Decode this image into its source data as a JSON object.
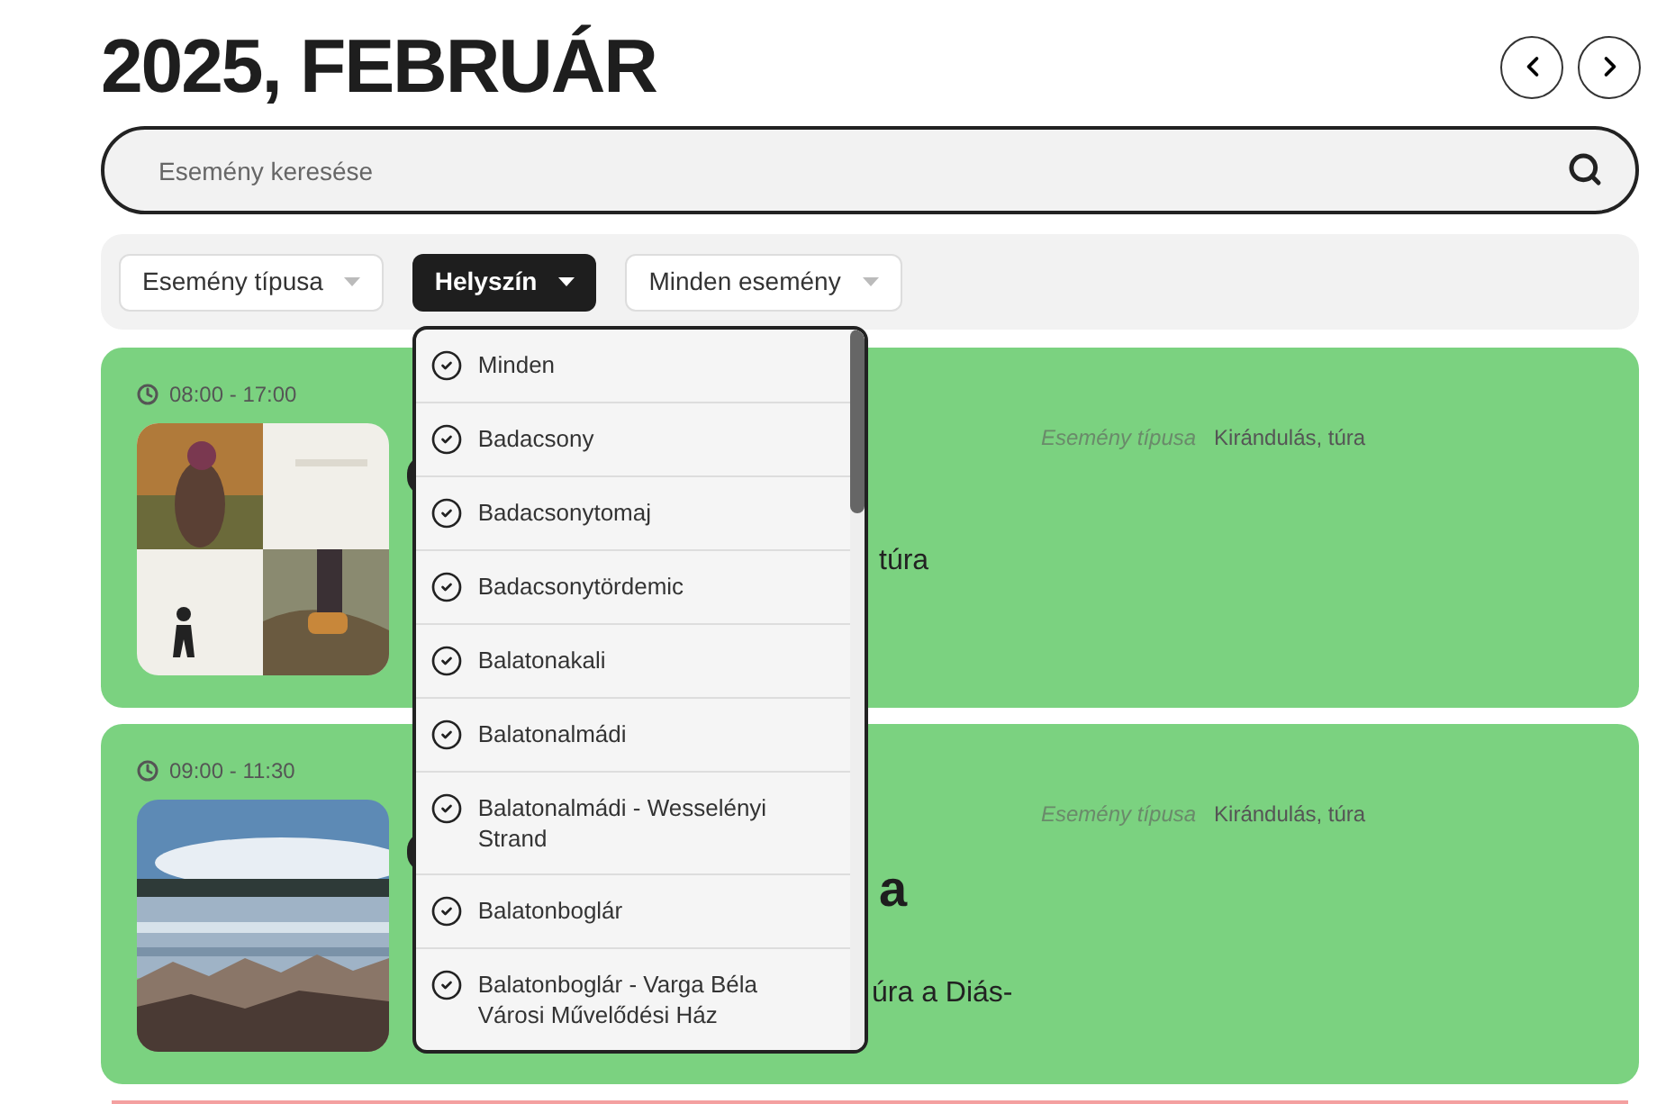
{
  "heading": "2025, FEBRUÁR",
  "search": {
    "placeholder": "Esemény keresése"
  },
  "filters": [
    {
      "label": "Esemény típusa",
      "selected": false
    },
    {
      "label": "Helyszín",
      "selected": true
    },
    {
      "label": "Minden esemény",
      "selected": false
    }
  ],
  "location_menu": {
    "items": [
      "Minden",
      "Badacsony",
      "Badacsonytomaj",
      "Badacsonytördemic",
      "Balatonakali",
      "Balatonalmádi",
      "Balatonalmádi - Wesselényi Strand",
      "Balatonboglár",
      "Balatonboglár - Varga Béla Városi Művelődési Ház"
    ]
  },
  "events": [
    {
      "time": "08:00 - 17:00",
      "description_fragment": "túra",
      "type_label": "Esemény típusa",
      "type_value": "Kirándulás, túra"
    },
    {
      "time": "09:00 - 11:30",
      "title_fragment": "a",
      "description_fragment": "úra a Diás-",
      "type_label": "Esemény típusa",
      "type_value": "Kirándulás, túra"
    }
  ]
}
